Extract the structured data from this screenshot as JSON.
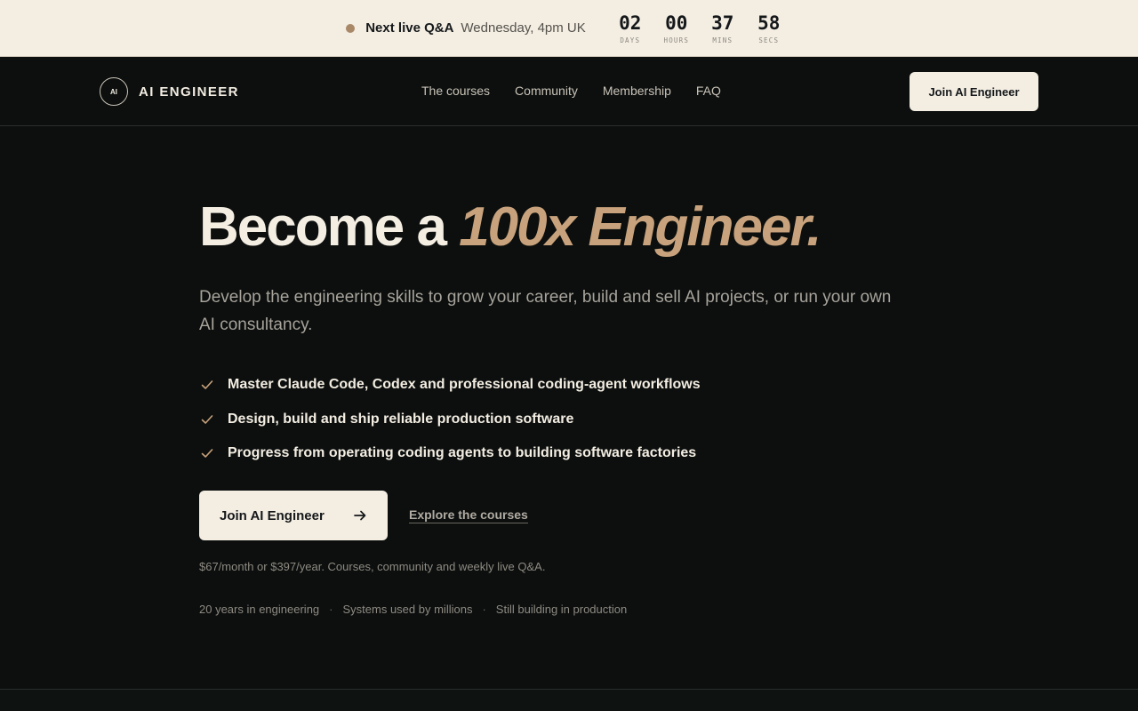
{
  "topbar": {
    "label": "Next live Q&A",
    "time": "Wednesday, 4pm UK",
    "countdown": [
      {
        "value": "02",
        "label": "DAYS"
      },
      {
        "value": "00",
        "label": "HOURS"
      },
      {
        "value": "37",
        "label": "MINS"
      },
      {
        "value": "58",
        "label": "SECS"
      }
    ]
  },
  "nav": {
    "brand_mark": "AI",
    "brand_name": "AI ENGINEER",
    "links": [
      "The courses",
      "Community",
      "Membership",
      "FAQ"
    ],
    "cta": "Join AI Engineer"
  },
  "hero": {
    "headline_lead": "Become a",
    "headline_accent": "100x Engineer.",
    "subhead": "Develop the engineering skills to grow your career, build and sell AI projects, or run your own AI consultancy.",
    "features": [
      "Master Claude Code, Codex and professional coding-agent workflows",
      "Design, build and ship reliable production software",
      "Progress from operating coding agents to building software factories"
    ],
    "primary_cta": "Join AI Engineer",
    "secondary_cta": "Explore the courses",
    "pricing": "$67/month or $397/year. Courses, community and weekly live Q&A.",
    "stats": [
      "20 years in engineering",
      "Systems used by millions",
      "Still building in production"
    ],
    "stat_separator": "·"
  },
  "icons": {
    "check": "check-icon",
    "arrow": "arrow-right-icon",
    "live": "live-dot-icon"
  },
  "colors": {
    "background": "#0c0f0e",
    "cream": "#f3ede2",
    "accent": "#c8a27c",
    "live_dot": "#a98868"
  }
}
